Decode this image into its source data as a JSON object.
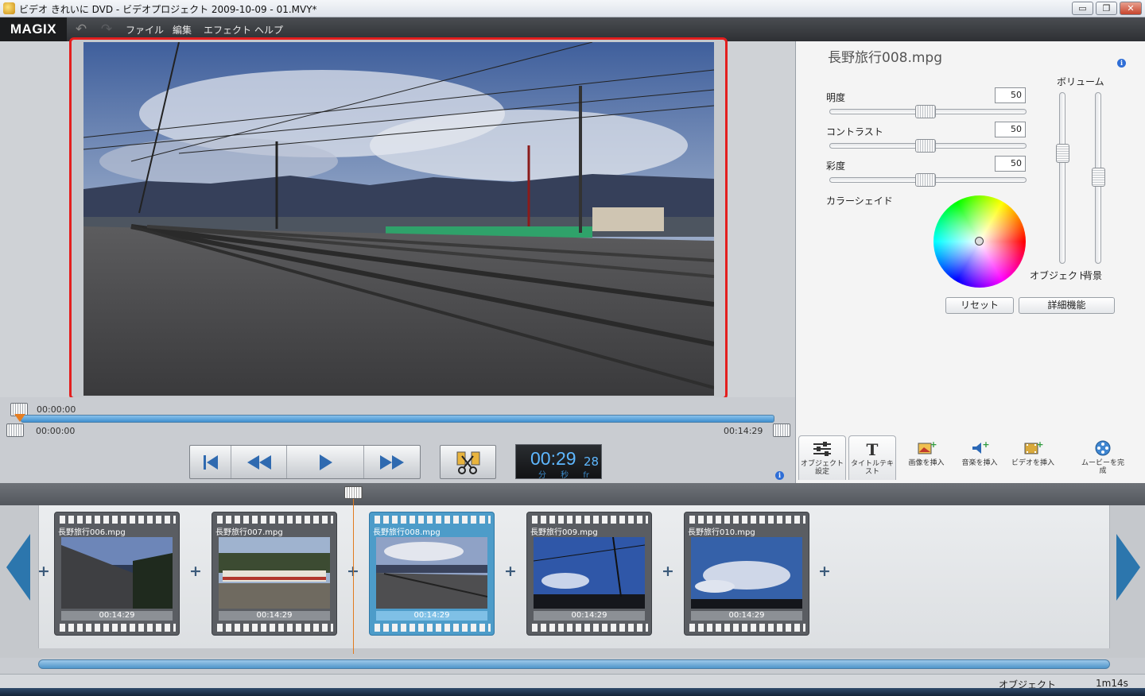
{
  "window": {
    "title": "ビデオ きれいに DVD - ビデオプロジェクト 2009-10-09 - 01.MVY*",
    "minimize": "▭",
    "restore": "❐",
    "close": "✕"
  },
  "menubar": {
    "logo": "MAGIX",
    "undo_icon": "undo-icon",
    "redo_icon": "redo-icon",
    "items": [
      "ファイル",
      "編集",
      "エフェクト",
      "ヘルプ"
    ]
  },
  "right_panel": {
    "clip_title": "長野旅行008.mpg",
    "info": "i",
    "brightness": {
      "label": "明度",
      "value": "50"
    },
    "contrast": {
      "label": "コントラスト",
      "value": "50"
    },
    "saturation": {
      "label": "彩度",
      "value": "50"
    },
    "color_shade_label": "カラーシェイド",
    "volume_label": "ボリューム",
    "object_label": "オブジェクト",
    "background_label": "背景",
    "reset_button": "リセット",
    "advanced_button": "詳細機能"
  },
  "tools": [
    {
      "label": "オブジェクト設定",
      "icon": "sliders-icon"
    },
    {
      "label": "タイトルテキスト",
      "icon": "title-t-icon"
    },
    {
      "label": "画像を挿入",
      "icon": "insert-image-icon"
    },
    {
      "label": "音楽を挿入",
      "icon": "insert-music-icon"
    },
    {
      "label": "ビデオを挿入",
      "icon": "insert-video-icon"
    },
    {
      "label": "ムービーを完成",
      "icon": "film-reel-icon"
    }
  ],
  "transport": {
    "start_tc": "00:00:00",
    "in_tc": "00:00:00",
    "end_tc": "00:14:29",
    "timecode_main": "00:29",
    "timecode_frames": "28",
    "timecode_units": "分 秒 fr",
    "info": "i"
  },
  "clips": [
    {
      "name": "長野旅行006.mpg",
      "duration": "00:14:29",
      "selected": false
    },
    {
      "name": "長野旅行007.mpg",
      "duration": "00:14:29",
      "selected": false
    },
    {
      "name": "長野旅行008.mpg",
      "duration": "00:14:29",
      "selected": true
    },
    {
      "name": "長野旅行009.mpg",
      "duration": "00:14:29",
      "selected": false
    },
    {
      "name": "長野旅行010.mpg",
      "duration": "00:14:29",
      "selected": false
    }
  ],
  "add_symbol": "+",
  "statusbar": {
    "mode": "オブジェクト",
    "length": "1m14s"
  },
  "colors": {
    "selection_outline": "#e31e1e",
    "accent_blue": "#4d9cc9",
    "playhead": "#e17b1f"
  }
}
